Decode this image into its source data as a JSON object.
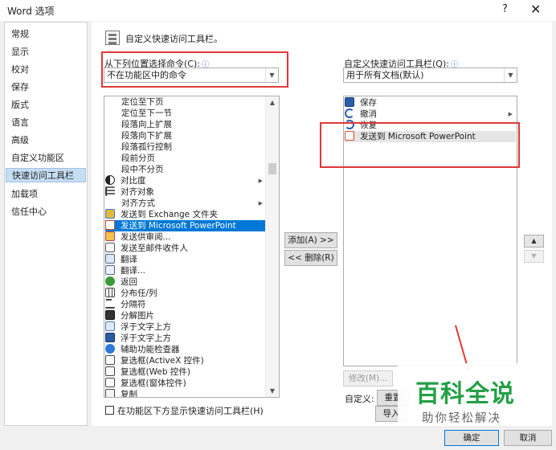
{
  "window": {
    "title": "Word 选项",
    "help": "?",
    "close": "✕"
  },
  "sidebar": {
    "items": [
      {
        "label": "常规",
        "active": false
      },
      {
        "label": "显示",
        "active": false
      },
      {
        "label": "校对",
        "active": false
      },
      {
        "label": "保存",
        "active": false
      },
      {
        "label": "版式",
        "active": false
      },
      {
        "label": "语言",
        "active": false
      },
      {
        "label": "高级",
        "active": false
      },
      {
        "label": "自定义功能区",
        "active": false
      },
      {
        "label": "快速访问工具栏",
        "active": true
      },
      {
        "label": "加载项",
        "active": false
      },
      {
        "label": "信任中心",
        "active": false
      }
    ]
  },
  "header": {
    "title": "自定义快速访问工具栏。"
  },
  "left": {
    "label": "从下列位置选择命令(C):",
    "info_icon": "ⓘ",
    "select_value": "不在功能区中的命令",
    "commands": [
      {
        "label": "定位至下页",
        "icon": "none"
      },
      {
        "label": "定位至下一节",
        "icon": "none"
      },
      {
        "label": "段落向上扩展",
        "icon": "none"
      },
      {
        "label": "段落向下扩展",
        "icon": "none"
      },
      {
        "label": "段落孤行控制",
        "icon": "none"
      },
      {
        "label": "段前分页",
        "icon": "none"
      },
      {
        "label": "段中不分页",
        "icon": "none"
      },
      {
        "label": "对比度",
        "icon": "contrast-icon",
        "submenu": true
      },
      {
        "label": "对齐对象",
        "icon": "align-icon"
      },
      {
        "label": "对齐方式",
        "icon": "none",
        "submenu": true
      },
      {
        "label": "发送到 Exchange 文件夹",
        "icon": "exchange-icon"
      },
      {
        "label": "发送到 Microsoft PowerPoint",
        "icon": "powerpoint-icon",
        "selected": true
      },
      {
        "label": "发送供审阅...",
        "icon": "review-icon"
      },
      {
        "label": "发送至邮件收件人",
        "icon": "mail-icon"
      },
      {
        "label": "翻译",
        "icon": "translate-icon"
      },
      {
        "label": "翻译...",
        "icon": "translate-dots-icon"
      },
      {
        "label": "返回",
        "icon": "back-icon"
      },
      {
        "label": "分布任/列",
        "icon": "distribute-icon"
      },
      {
        "label": "分隔符",
        "icon": "separator-icon"
      },
      {
        "label": "分解图片",
        "icon": "ungroup-picture-icon"
      },
      {
        "label": "浮于文字上方",
        "icon": "float-icon"
      },
      {
        "label": "浮于文字上方",
        "icon": "float-front-icon"
      },
      {
        "label": "辅助功能检查器",
        "icon": "accessibility-icon"
      },
      {
        "label": "复选框(ActiveX 控件)",
        "icon": "checkbox-icon"
      },
      {
        "label": "复选框(Web 控件)",
        "icon": "checkbox-icon"
      },
      {
        "label": "复选框(窗体控件)",
        "icon": "checkbox-icon"
      },
      {
        "label": "复制",
        "icon": "copy-icon"
      }
    ],
    "below_ribbon_checkbox": "在功能区下方显示快速访问工具栏(H)"
  },
  "middle": {
    "add": "添加(A) >>",
    "remove": "<< 删除(R)"
  },
  "right": {
    "label": "自定义快速访问工具栏(Q):",
    "info_icon": "ⓘ",
    "select_value": "用于所有文档(默认)",
    "items": [
      {
        "label": "保存",
        "icon": "save-icon"
      },
      {
        "label": "撤消",
        "icon": "undo-icon",
        "submenu": true
      },
      {
        "label": "恢复",
        "icon": "redo-icon"
      },
      {
        "label": "发送到 Microsoft PowerPoint",
        "icon": "powerpoint-icon",
        "highlighted": true
      }
    ],
    "modify_button": "修改(M)...",
    "customize_label": "自定义:",
    "reset_button": "重置",
    "import_button": "导入"
  },
  "move": {
    "up": "▲",
    "down": "▼"
  },
  "footer": {
    "ok": "确定",
    "cancel": "取消"
  },
  "watermark": {
    "title": "百科全说",
    "subtitle": "助你轻松解决"
  },
  "colors": {
    "selection": "#0078d7",
    "annotation": "#e13737",
    "watermark": "#23a045"
  }
}
